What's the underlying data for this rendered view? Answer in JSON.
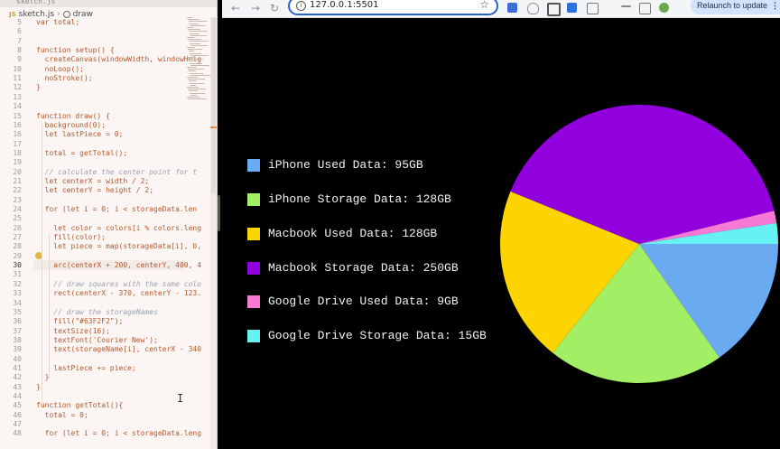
{
  "editor": {
    "breadcrumb": {
      "file": "sketch.js",
      "symbol": "draw",
      "file_badge": "JS"
    },
    "lines": [
      {
        "n": "5",
        "text": "var total;"
      },
      {
        "n": "6",
        "text": ""
      },
      {
        "n": "7",
        "text": ""
      },
      {
        "n": "8",
        "text": "function setup() {"
      },
      {
        "n": "9",
        "text": "  createCanvas(windowWidth, windowHeig"
      },
      {
        "n": "10",
        "text": "  noLoop();"
      },
      {
        "n": "11",
        "text": "  noStroke();"
      },
      {
        "n": "12",
        "text": "}"
      },
      {
        "n": "13",
        "text": ""
      },
      {
        "n": "14",
        "text": ""
      },
      {
        "n": "15",
        "text": "function draw() {"
      },
      {
        "n": "16",
        "text": "  background(0);"
      },
      {
        "n": "16",
        "text": "  let lastPiece = 0;"
      },
      {
        "n": "17",
        "text": ""
      },
      {
        "n": "18",
        "text": "  total = getTotal();"
      },
      {
        "n": "19",
        "text": ""
      },
      {
        "n": "20",
        "text": "  // calculate the center point for t"
      },
      {
        "n": "21",
        "text": "  let centerX = width / 2;"
      },
      {
        "n": "22",
        "text": "  let centerY = height / 2;"
      },
      {
        "n": "23",
        "text": ""
      },
      {
        "n": "24",
        "text": "  for (let i = 0; i < storageData.len"
      },
      {
        "n": "25",
        "text": ""
      },
      {
        "n": "26",
        "text": "    let color = colors[i % colors.leng"
      },
      {
        "n": "27",
        "text": "    fill(color);"
      },
      {
        "n": "28",
        "text": "    let piece = map(storageData[i], 0,"
      },
      {
        "n": "29",
        "text": ""
      },
      {
        "n": "30",
        "text": "    arc(centerX + 200, centerY, 400, 4"
      },
      {
        "n": "31",
        "text": ""
      },
      {
        "n": "32",
        "text": "    // draw squares with the same colo"
      },
      {
        "n": "33",
        "text": "    rect(centerX - 370, centerY - 123."
      },
      {
        "n": "34",
        "text": ""
      },
      {
        "n": "35",
        "text": "    // draw the storageNames"
      },
      {
        "n": "36",
        "text": "    fill(\"#63F2F2\");"
      },
      {
        "n": "37",
        "text": "    textSize(16);"
      },
      {
        "n": "38",
        "text": "    textFont('Courier New');"
      },
      {
        "n": "39",
        "text": "    text(storageName[i], centerX - 340"
      },
      {
        "n": "40",
        "text": ""
      },
      {
        "n": "41",
        "text": "    lastPiece += piece;"
      },
      {
        "n": "42",
        "text": "  }"
      },
      {
        "n": "43",
        "text": "}"
      },
      {
        "n": "44",
        "text": ""
      },
      {
        "n": "45",
        "text": "function getTotal(){"
      },
      {
        "n": "46",
        "text": "  total = 0;"
      },
      {
        "n": "47",
        "text": ""
      },
      {
        "n": "48",
        "text": "  for (let i = 0; i < storageData.leng"
      }
    ]
  },
  "browser": {
    "url": "127.0.0.1:5501",
    "relaunch_label": "Relaunch to update",
    "relaunch_more": "⋮",
    "back_icon": "←",
    "forward_icon": "→",
    "reload_icon": "↻",
    "star_icon": "☆",
    "info_icon": "i"
  },
  "legend": [
    {
      "label": "iPhone Used Data: 95GB",
      "color": "#6aaaf1"
    },
    {
      "label": "iPhone Storage Data: 128GB",
      "color": "#a2ee64"
    },
    {
      "label": "Macbook Used Data: 128GB",
      "color": "#fcd402"
    },
    {
      "label": "Macbook Storage Data: 250GB",
      "color": "#9100dd"
    },
    {
      "label": "Google Drive Used Data: 9GB",
      "color": "#f779d4"
    },
    {
      "label": "Google Drive Storage Data: 15GB",
      "color": "#66f2f2"
    }
  ],
  "chart_data": {
    "type": "pie",
    "categories": [
      "iPhone Used Data",
      "iPhone Storage Data",
      "Macbook Used Data",
      "Macbook Storage Data",
      "Google Drive Used Data",
      "Google Drive Storage Data"
    ],
    "values": [
      95,
      128,
      128,
      250,
      9,
      15
    ],
    "colors": [
      "#6aaaf1",
      "#a2ee64",
      "#fcd402",
      "#9100dd",
      "#f779d4",
      "#66f2f2"
    ]
  }
}
